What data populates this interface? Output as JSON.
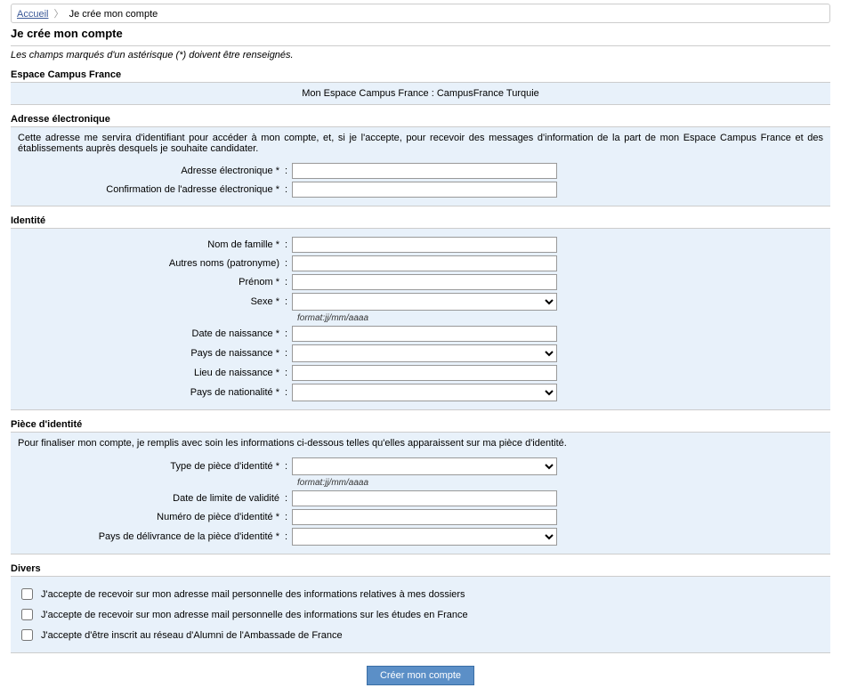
{
  "breadcrumb": {
    "home": "Accueil",
    "current": "Je crée mon compte"
  },
  "page_title": "Je crée mon compte",
  "mandatory_note": "Les champs marqués d'un astérisque (*) doivent être renseignés.",
  "espace": {
    "header": "Espace Campus France",
    "line": "Mon Espace Campus France  :  CampusFrance Turquie"
  },
  "email": {
    "header": "Adresse électronique",
    "desc": "Cette adresse me servira d'identifiant pour accéder à mon compte, et, si je l'accepte, pour recevoir des messages d'information de la part de mon Espace Campus France et des établissements auprès desquels je souhaite candidater.",
    "label_email": "Adresse électronique *",
    "label_confirm": "Confirmation de l'adresse électronique *",
    "value_email": "",
    "value_confirm": ""
  },
  "identity": {
    "header": "Identité",
    "label_lastname": "Nom de famille *",
    "label_othernames": "Autres noms (patronyme)",
    "label_firstname": "Prénom *",
    "label_sex": "Sexe *",
    "label_dob": "Date de naissance *",
    "label_country_birth": "Pays de naissance *",
    "label_place_birth": "Lieu de naissance *",
    "label_nationality": "Pays de nationalité *",
    "hint_date": "format:jj/mm/aaaa",
    "value_lastname": "",
    "value_othernames": "",
    "value_firstname": "",
    "value_sex": "",
    "value_dob": "",
    "value_country_birth": "",
    "value_place_birth": "",
    "value_nationality": ""
  },
  "idcard": {
    "header": "Pièce d'identité",
    "desc": "Pour finaliser mon compte, je remplis avec soin les informations ci-dessous telles qu'elles apparaissent sur ma pièce d'identité.",
    "label_type": "Type de pièce d'identité *",
    "label_expiry": "Date de limite de validité",
    "label_number": "Numéro de pièce d'identité *",
    "label_issue_country": "Pays de délivrance de la pièce d'identité *",
    "hint_date": "format:jj/mm/aaaa",
    "value_type": "",
    "value_expiry": "",
    "value_number": "",
    "value_issue_country": ""
  },
  "divers": {
    "header": "Divers",
    "opt1": "J'accepte de recevoir sur mon adresse mail personnelle des informations relatives à mes dossiers",
    "opt2": "J'accepte de recevoir sur mon adresse mail personnelle des informations sur les études en France",
    "opt3": "J'accepte d'être inscrit au réseau d'Alumni de l'Ambassade de France"
  },
  "submit_label": "Créer mon compte",
  "colon": ":"
}
